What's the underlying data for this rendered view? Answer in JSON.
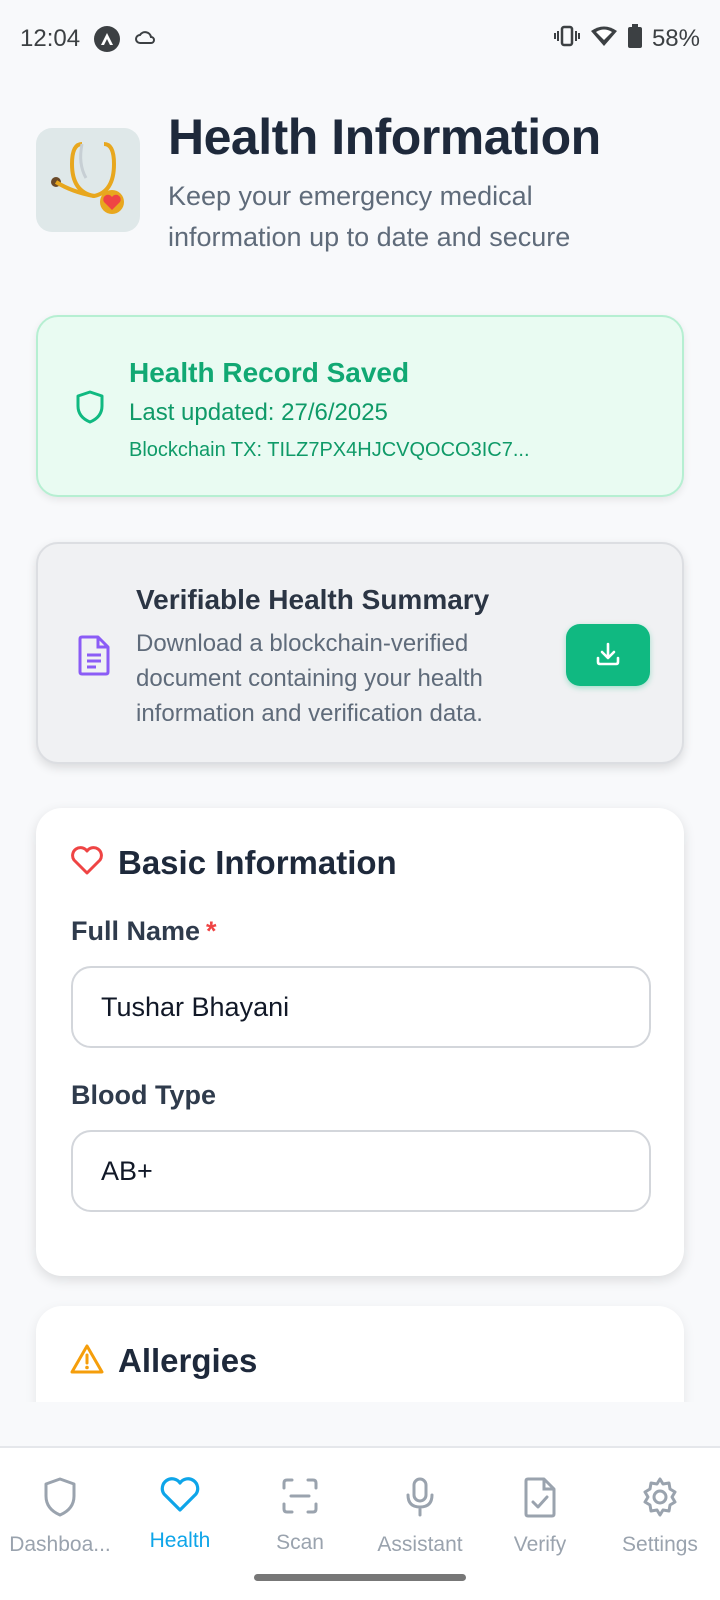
{
  "status_bar": {
    "time": "12:04",
    "battery": "58%"
  },
  "header": {
    "title": "Health Information",
    "subtitle": "Keep your emergency medical information up to date and secure"
  },
  "saved_card": {
    "title": "Health Record Saved",
    "last_updated": "Last updated: 27/6/2025",
    "tx": "Blockchain TX: TILZ7PX4HJCVQOCO3IC7..."
  },
  "summary_card": {
    "title": "Verifiable Health Summary",
    "description": "Download a blockchain-verified document containing your health information and verification data."
  },
  "basic_info": {
    "title": "Basic Information",
    "full_name_label": "Full Name",
    "required_mark": "*",
    "full_name_value": "Tushar Bhayani",
    "blood_type_label": "Blood Type",
    "blood_type_value": "AB+"
  },
  "allergies": {
    "title": "Allergies"
  },
  "nav": {
    "items": [
      {
        "label": "Dashboa...",
        "icon": "shield-icon"
      },
      {
        "label": "Health",
        "icon": "heart-icon",
        "active": true
      },
      {
        "label": "Scan",
        "icon": "scan-icon"
      },
      {
        "label": "Assistant",
        "icon": "mic-icon"
      },
      {
        "label": "Verify",
        "icon": "file-check-icon"
      },
      {
        "label": "Settings",
        "icon": "gear-icon"
      }
    ]
  },
  "colors": {
    "accent": "#0ea5e9",
    "success": "#10b981",
    "required": "#ef4444",
    "warning": "#f59e0b",
    "summary_icon": "#8b5cf6"
  }
}
